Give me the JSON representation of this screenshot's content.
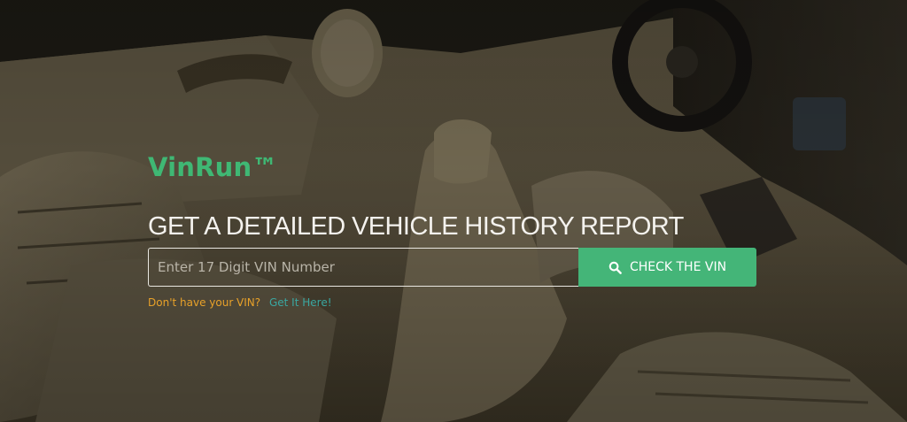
{
  "brand": {
    "name": "VinRun™"
  },
  "hero": {
    "headline": "GET A DETAILED VEHICLE HISTORY REPORT"
  },
  "search": {
    "placeholder": "Enter 17 Digit VIN Number",
    "value": "",
    "button_label": "CHECK THE VIN",
    "button_icon": "search-icon"
  },
  "helper": {
    "question": "Don't have your VIN?",
    "link_label": "Get It Here!"
  },
  "colors": {
    "brand_green": "#3fb874",
    "button_green": "#44b578",
    "question_orange": "#e8a229",
    "link_teal": "#3aa7a0"
  }
}
